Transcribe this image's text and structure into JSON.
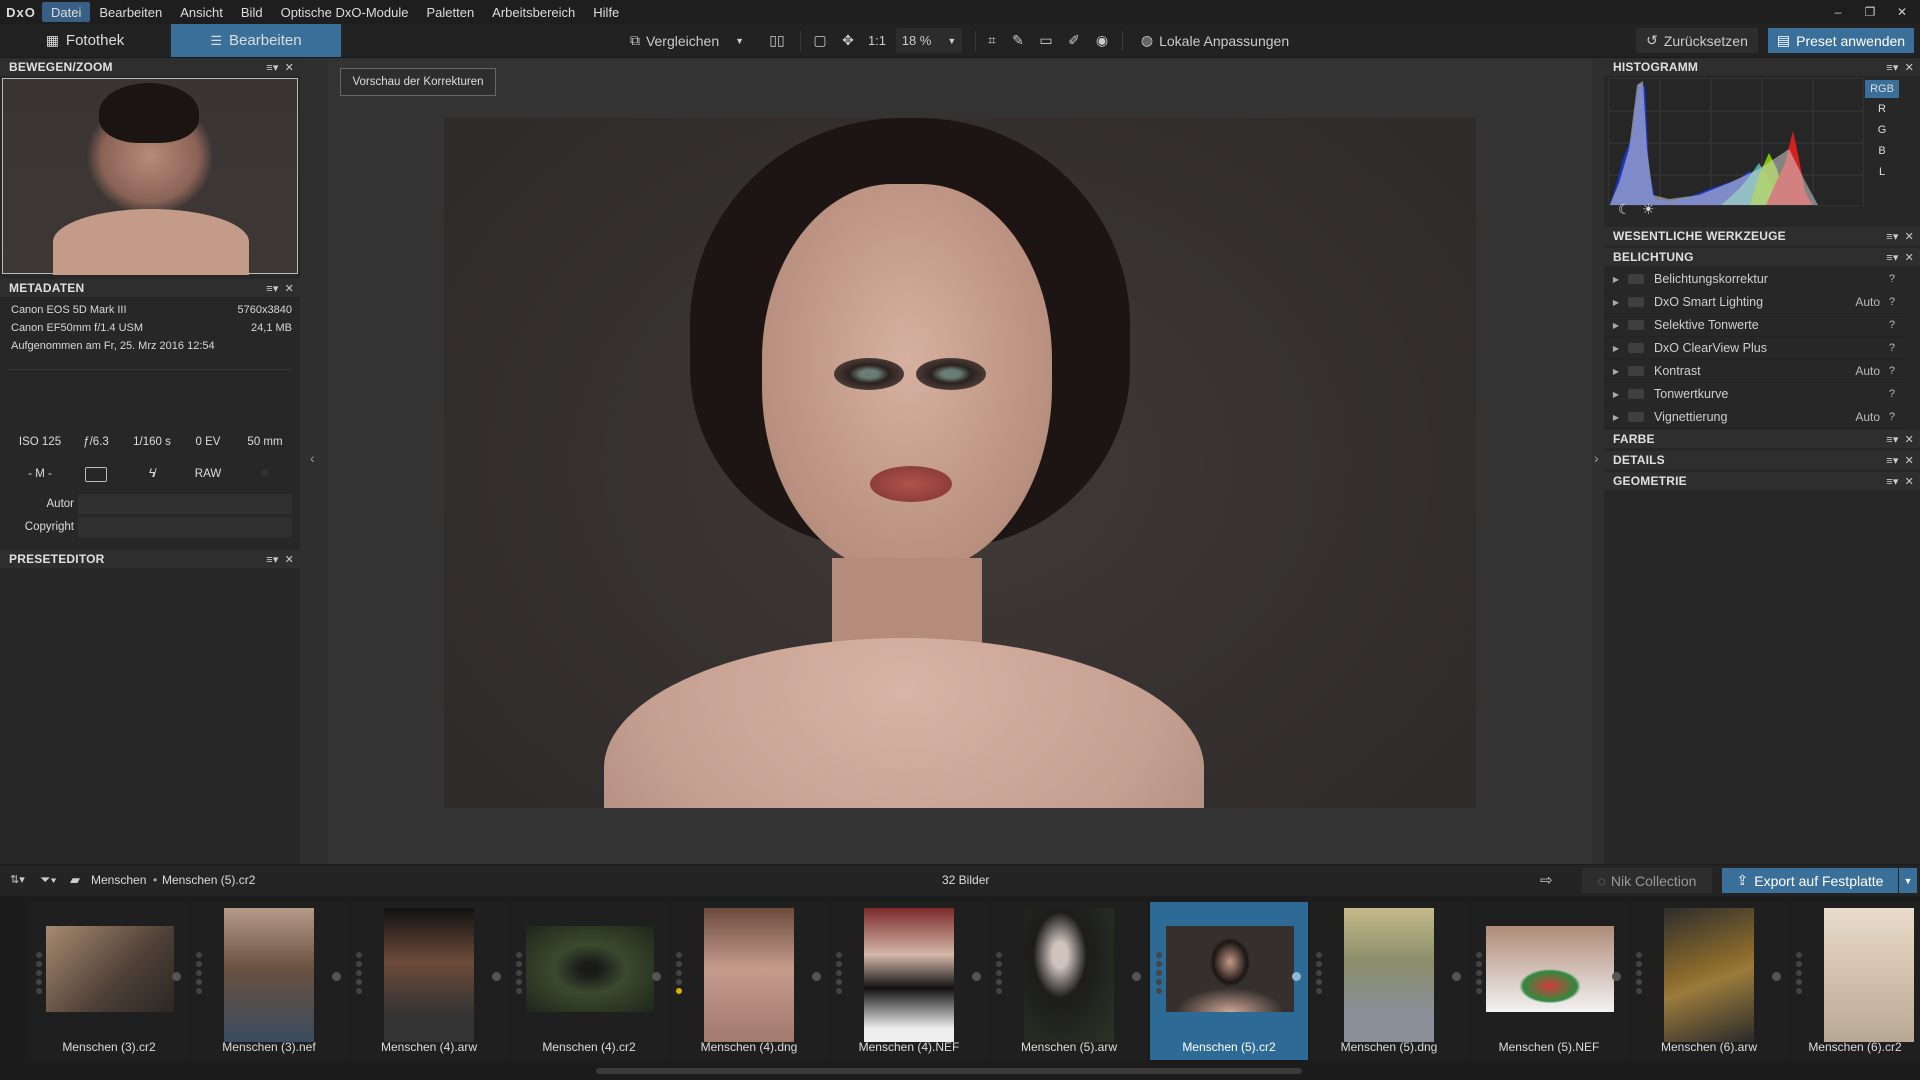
{
  "app": {
    "logo": "DxO"
  },
  "menu": [
    "Datei",
    "Bearbeiten",
    "Ansicht",
    "Bild",
    "Optische DxO-Module",
    "Paletten",
    "Arbeitsbereich",
    "Hilfe"
  ],
  "window_controls": {
    "minimize": "–",
    "restore": "❐",
    "close": "✕"
  },
  "tabs": {
    "fotothek": "Fotothek",
    "bearbeiten": "Bearbeiten"
  },
  "toolbar": {
    "compare_label": "Vergleichen",
    "one_to_one": "1:1",
    "zoom": "18 %",
    "local_adjust": "Lokale Anpassungen",
    "reset": "Zurücksetzen",
    "apply_preset": "Preset anwenden"
  },
  "panels": {
    "move_zoom": "BEWEGEN/ZOOM",
    "metadata": "METADATEN",
    "preset_editor": "PRESETEDITOR",
    "histogram": "HISTOGRAMM",
    "essential_tools": "WESENTLICHE WERKZEUGE",
    "exposure": "BELICHTUNG",
    "color": "FARBE",
    "details": "DETAILS",
    "geometry": "GEOMETRIE"
  },
  "metadata": {
    "camera": "Canon EOS 5D Mark III",
    "resolution": "5760x3840",
    "lens": "Canon EF50mm f/1.4 USM",
    "filesize": "24,1 MB",
    "taken": "Aufgenommen am Fr, 25. Mrz 2016 12:54",
    "iso": "ISO 125",
    "aperture": "ƒ/6.3",
    "shutter": "1/160 s",
    "ev": "0 EV",
    "focal": "50 mm",
    "mode": "- M -",
    "format": "RAW",
    "author_label": "Autor",
    "copyright_label": "Copyright",
    "author_value": "",
    "copyright_value": ""
  },
  "histogram": {
    "channels": [
      "RGB",
      "R",
      "G",
      "B",
      "L"
    ],
    "active": "RGB"
  },
  "exposure_tools": [
    {
      "name": "Belichtungskorrektur",
      "auto": ""
    },
    {
      "name": "DxO Smart Lighting",
      "auto": "Auto"
    },
    {
      "name": "Selektive Tonwerte",
      "auto": ""
    },
    {
      "name": "DxO ClearView Plus",
      "auto": ""
    },
    {
      "name": "Kontrast",
      "auto": "Auto"
    },
    {
      "name": "Tonwertkurve",
      "auto": ""
    },
    {
      "name": "Vignettierung",
      "auto": "Auto"
    }
  ],
  "preview_button": "Vorschau der Korrekturen",
  "filmbar": {
    "folder": "Menschen",
    "file": "Menschen (5).cr2",
    "count": "32 Bilder",
    "nik": "Nik Collection",
    "export": "Export auf Festplatte"
  },
  "thumbnails": [
    {
      "name": "Menschen (3).cr2"
    },
    {
      "name": "Menschen (3).nef"
    },
    {
      "name": "Menschen (4).arw"
    },
    {
      "name": "Menschen (4).cr2"
    },
    {
      "name": "Menschen (4).dng"
    },
    {
      "name": "Menschen (4).NEF"
    },
    {
      "name": "Menschen (5).arw"
    },
    {
      "name": "Menschen (5).cr2"
    },
    {
      "name": "Menschen (5).dng"
    },
    {
      "name": "Menschen (5).NEF"
    },
    {
      "name": "Menschen (6).arw"
    },
    {
      "name": "Menschen (6).cr2"
    }
  ],
  "colors": {
    "accent": "#3a6f99",
    "selected_thumb": "#2d6b96"
  }
}
